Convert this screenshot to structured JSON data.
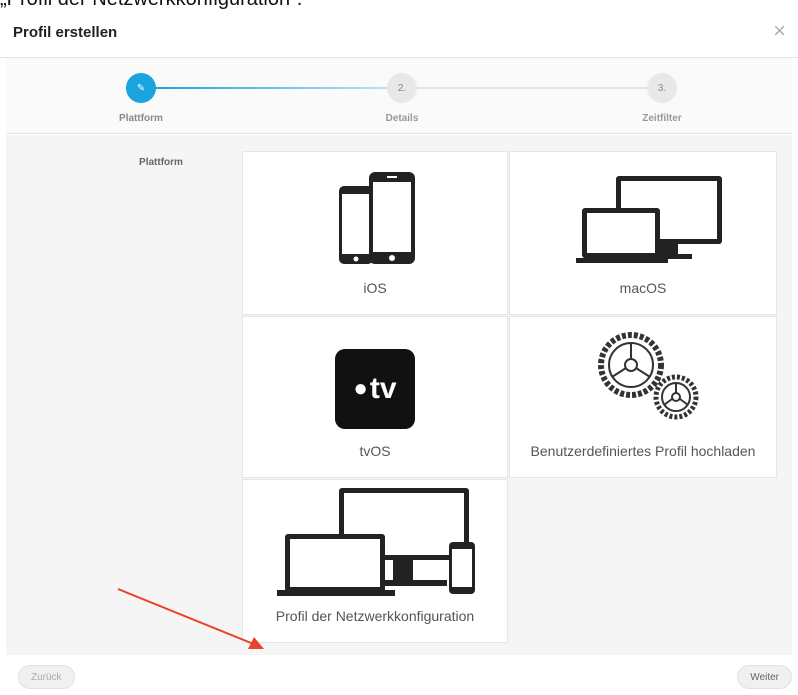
{
  "caption": "„Profil der Netzwerkkonfiguration“.",
  "dialog": {
    "title": "Profil erstellen",
    "close_label": "×"
  },
  "steps": [
    {
      "label": "Plattform",
      "marker": "✎",
      "active": true
    },
    {
      "label": "Details",
      "marker": "2.",
      "active": false
    },
    {
      "label": "Zeitfilter",
      "marker": "3.",
      "active": false
    }
  ],
  "section_label": "Plattform",
  "tiles": [
    {
      "label": "iOS",
      "icon": "iphone-devices-icon"
    },
    {
      "label": "macOS",
      "icon": "mac-devices-icon"
    },
    {
      "label": "tvOS",
      "icon": "apple-tv-icon"
    },
    {
      "label": "Benutzerdefiniertes Profil hochladen",
      "icon": "gears-icon"
    },
    {
      "label": "Profil der Netzwerkkonfiguration",
      "icon": "all-devices-icon"
    }
  ],
  "appletv_text": "tv",
  "footer": {
    "back_label": "Zurück",
    "next_label": "Weiter"
  },
  "colors": {
    "accent": "#1aa3dc",
    "arrow": "#e8432d"
  }
}
